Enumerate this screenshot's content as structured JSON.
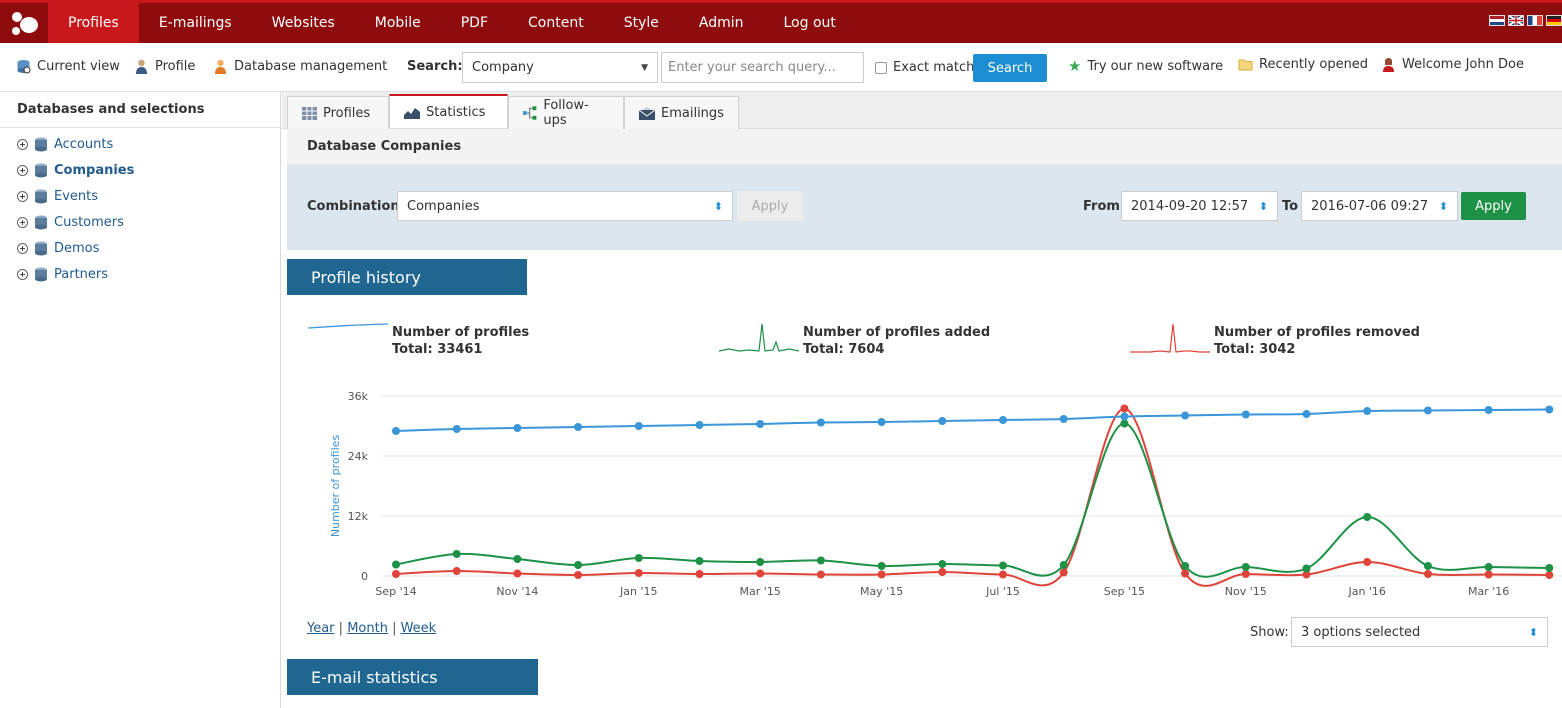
{
  "nav": {
    "items": [
      "Profiles",
      "E-mailings",
      "Websites",
      "Mobile",
      "PDF",
      "Content",
      "Style",
      "Admin",
      "Log out"
    ],
    "active": 0
  },
  "toolbar": {
    "current_view": "Current view",
    "profile": "Profile",
    "database_management": "Database management",
    "search_label": "Search:",
    "search_scope": "Company",
    "search_placeholder": "Enter your search query...",
    "exact_match": "Exact match",
    "search_button": "Search",
    "try_new": "Try our new software",
    "recently_opened": "Recently opened",
    "welcome": "Welcome John Doe"
  },
  "sidebar": {
    "title": "Databases and selections",
    "items": [
      {
        "label": "Accounts"
      },
      {
        "label": "Companies"
      },
      {
        "label": "Events"
      },
      {
        "label": "Customers"
      },
      {
        "label": "Demos"
      },
      {
        "label": "Partners"
      }
    ]
  },
  "tabs": [
    "Profiles",
    "Statistics",
    "Follow-ups",
    "Emailings"
  ],
  "db_title": "Database Companies",
  "filter": {
    "combination_label": "Combination",
    "combination_value": "Companies",
    "apply_disabled": "Apply",
    "from_label": "From",
    "from_value": "2014-09-20 12:57",
    "to_label": "To",
    "to_value": "2016-07-06 09:27",
    "apply": "Apply"
  },
  "profile_history": {
    "title": "Profile history",
    "legend": [
      {
        "name": "Number of profiles",
        "total": "Total: 33461",
        "color": "#3b96d9"
      },
      {
        "name": "Number of profiles added",
        "total": "Total: 7604",
        "color": "#1d9146"
      },
      {
        "name": "Number of profiles removed",
        "total": "Total: 3042",
        "color": "#e0433a"
      }
    ],
    "granularity": [
      "Year",
      "Month",
      "Week"
    ],
    "show_label": "Show:",
    "show_value": "3 options selected"
  },
  "email_statistics": {
    "title": "E-mail statistics"
  },
  "chart_data": {
    "type": "line",
    "ylabel": "Number of profiles",
    "yticks": [
      "0",
      "12k",
      "24k",
      "36k"
    ],
    "ylim": [
      0,
      36000
    ],
    "x": [
      "2014-09",
      "2014-10",
      "2014-11",
      "2014-12",
      "2015-01",
      "2015-02",
      "2015-03",
      "2015-04",
      "2015-05",
      "2015-06",
      "2015-07",
      "2015-08",
      "2015-09",
      "2015-10",
      "2015-11",
      "2015-12",
      "2016-01",
      "2016-02",
      "2016-03",
      "2016-04"
    ],
    "xtick_labels": [
      "Sep '14",
      "Nov '14",
      "Jan '15",
      "Mar '15",
      "May '15",
      "Jul '15",
      "Sep '15",
      "Nov '15",
      "Jan '16",
      "Mar '16"
    ],
    "series": [
      {
        "name": "Number of profiles",
        "color": "#3b96d9",
        "values": [
          29000,
          29400,
          29600,
          29800,
          30000,
          30200,
          30400,
          30700,
          30800,
          31000,
          31200,
          31400,
          31900,
          32100,
          32300,
          32400,
          33000,
          33100,
          33200,
          33300
        ]
      },
      {
        "name": "Number of profiles added",
        "color": "#1d9146",
        "values": [
          2300,
          4400,
          3400,
          2200,
          3600,
          3000,
          2800,
          3100,
          2000,
          2400,
          2100,
          2200,
          30500,
          2000,
          1800,
          1500,
          11800,
          2000,
          1800,
          1600
        ]
      },
      {
        "name": "Number of profiles removed",
        "color": "#e0433a",
        "values": [
          400,
          1000,
          500,
          200,
          600,
          400,
          500,
          300,
          300,
          800,
          300,
          700,
          33500,
          500,
          400,
          300,
          2800,
          400,
          300,
          200
        ]
      }
    ]
  }
}
